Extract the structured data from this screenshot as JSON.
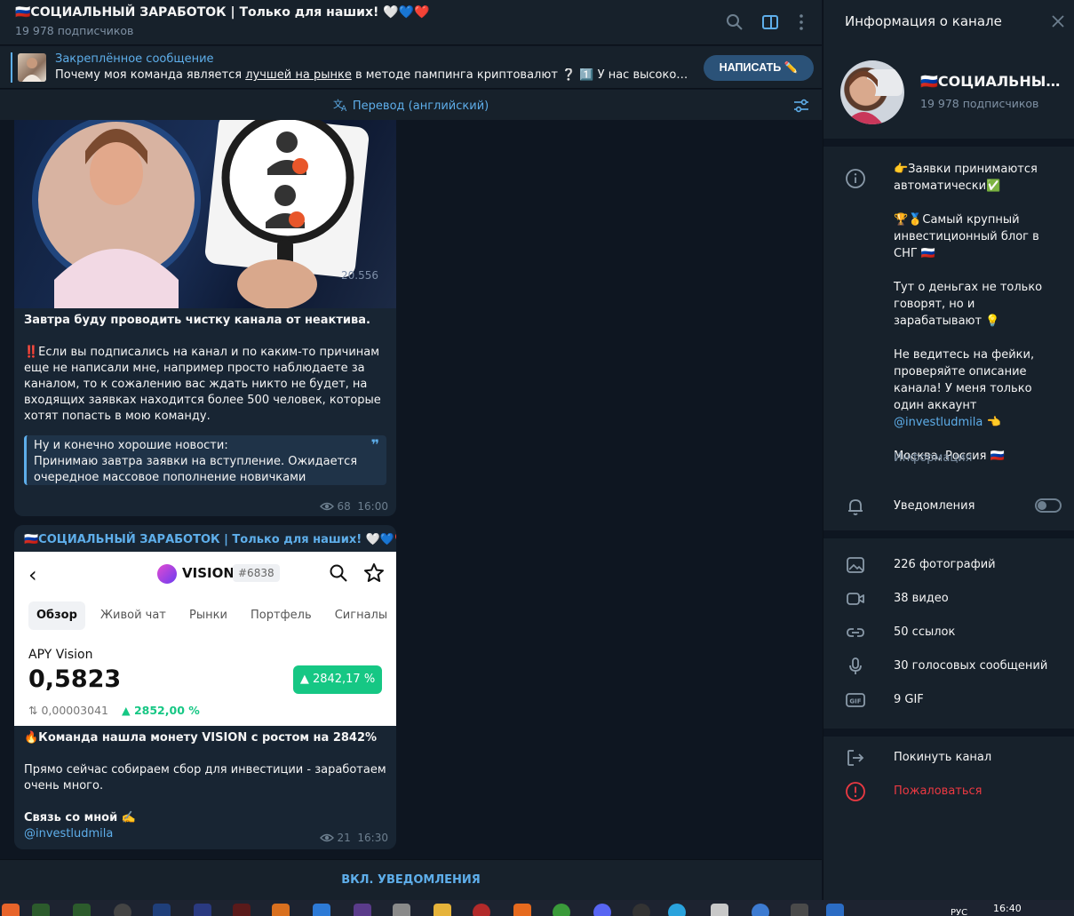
{
  "chat": {
    "title": "🇷🇺СОЦИАЛЬНЫЙ ЗАРАБОТОК | Только для наших! 🤍💙❤️",
    "subscribers": "19 978 подписчиков",
    "pinned_label": "Закреплённое сообщение",
    "pinned_text_before": "Почему моя команда является ",
    "pinned_text_underline": "лучшей на рынке",
    "pinned_text_after": " в методе пампинга криптовалют ❔ 1️⃣ У нас высококвалифицированные",
    "write_button": "НАПИСАТЬ ✏️",
    "translate": "Перевод (английский)",
    "notify_button": "ВКЛ. УВЕДОМЛЕНИЯ"
  },
  "messages": [
    {
      "image_text": "20.556",
      "line1": "Завтра буду проводить чистку канала от неактива.",
      "paragraph": "‼️Если вы подписались на канал и по каким-то причинам еще не написали мне, например просто наблюдаете за каналом, то к сожалению вас ждать никто не будет, на входящих заявках находится более 500 человек, которые хотят попасть в мою команду.",
      "quote": "Ну и конечно хорошие новости:\nПринимаю завтра заявки на вступление. Ожидается очередное массовое пополнение новичками",
      "views": "68",
      "time": "16:00"
    },
    {
      "author": "🇷🇺СОЦИАЛЬНЫЙ ЗАРАБОТОК | Только для наших! 🤍💙❤️",
      "vision": {
        "name": "VISION",
        "rank": "#6838",
        "tabs": [
          "Обзор",
          "Живой чат",
          "Рынки",
          "Портфель",
          "Сигналы"
        ],
        "pair": "APY Vision",
        "price": "0,5823",
        "change": "▲ 2842,17 %",
        "btc_price": "⇅ 0,00003041",
        "btc_change": "▲ 2852,00 %"
      },
      "line1": "🔥Команда нашла монету VISION с ростом на 2842%",
      "line2": "Прямо сейчас собираем сбор для инвестиции - заработаем очень много.",
      "line3": "Связь со мной ✍️",
      "link": "@investludmila",
      "views": "21",
      "time": "16:30"
    }
  ],
  "panel": {
    "title": "Информация о канале",
    "name": "🇷🇺СОЦИАЛЬНЫЙ ЗАРАБОТОК | Только для наших! 🤍💙❤️",
    "subscribers": "19 978 подписчиков",
    "desc1": "👉Заявки принимаются автоматически✅",
    "desc2": "🏆🥇Самый крупный инвестиционный блог в СНГ 🇷🇺",
    "desc3": "Тут о деньгах не только говорят, но и зарабатывают 💡",
    "desc4_before": "Не ведитесь на фейки, проверяйте описание канала! У меня только один аккаунт ",
    "desc4_link": "@investludmila",
    "desc4_after": " 👈",
    "desc5": "Москва, Россия 🇷🇺",
    "info_label": "Информация",
    "notifications": "Уведомления",
    "media": [
      "226 фотографий",
      "38 видео",
      "50 ссылок",
      "30 голосовых сообщений",
      "9 GIF"
    ],
    "leave": "Покинуть канал",
    "report": "Пожаловаться"
  },
  "taskbar": {
    "lang": "РУС",
    "time": "16:40"
  },
  "colors": {
    "accent": "#5eaeea",
    "background": "#0e1621",
    "panel": "#17212b",
    "bubble": "#182533",
    "danger": "#ec3942",
    "positive": "#16c784"
  }
}
